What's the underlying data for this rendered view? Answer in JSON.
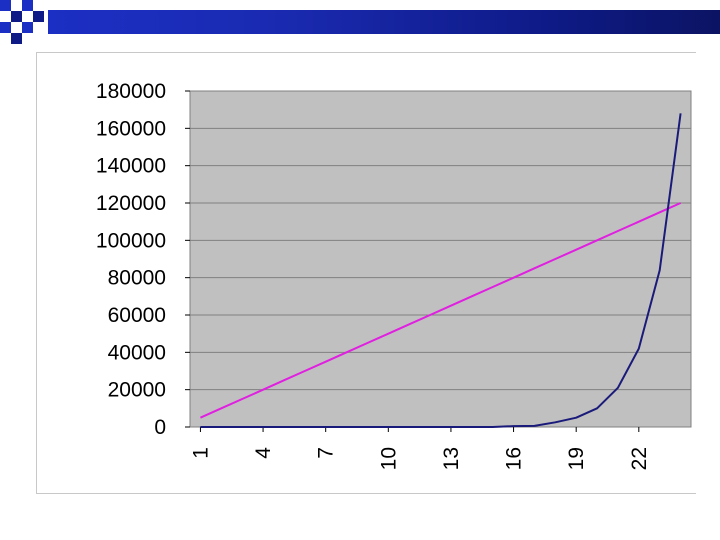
{
  "chart_data": {
    "type": "line",
    "title": "",
    "xlabel": "",
    "ylabel": "",
    "x": [
      1,
      2,
      3,
      4,
      5,
      6,
      7,
      8,
      9,
      10,
      11,
      12,
      13,
      14,
      15,
      16,
      17,
      18,
      19,
      20,
      21,
      22,
      23,
      24
    ],
    "x_tick_labels": [
      "1",
      "4",
      "7",
      "10",
      "13",
      "16",
      "19",
      "22"
    ],
    "y_tick_labels": [
      "180000",
      "160000",
      "140000",
      "120000",
      "100000",
      "80000",
      "60000",
      "40000",
      "20000",
      "0"
    ],
    "ylim": [
      0,
      180000
    ],
    "grid": "horizontal",
    "plot_background": "#c0c0c0",
    "series": [
      {
        "color": "#e020e0",
        "values": [
          5000,
          10000,
          15000,
          20000,
          25000,
          30000,
          35000,
          40000,
          45000,
          50000,
          55000,
          60000,
          65000,
          70000,
          75000,
          80000,
          85000,
          90000,
          95000,
          100000,
          105000,
          110000,
          115000,
          120000
        ]
      },
      {
        "color": "#1a1a7a",
        "values": [
          0,
          0,
          0,
          0,
          0,
          0,
          0,
          0,
          0,
          0,
          0,
          0,
          0,
          0,
          0,
          500,
          600,
          2500,
          5000,
          10000,
          21000,
          42000,
          84000,
          168000
        ]
      }
    ]
  },
  "header": {
    "bar_color_start": "#1b2fc4",
    "bar_color_end": "#0b1463",
    "checker_colors": [
      "#1b2fc4",
      "#0e1a86"
    ]
  }
}
